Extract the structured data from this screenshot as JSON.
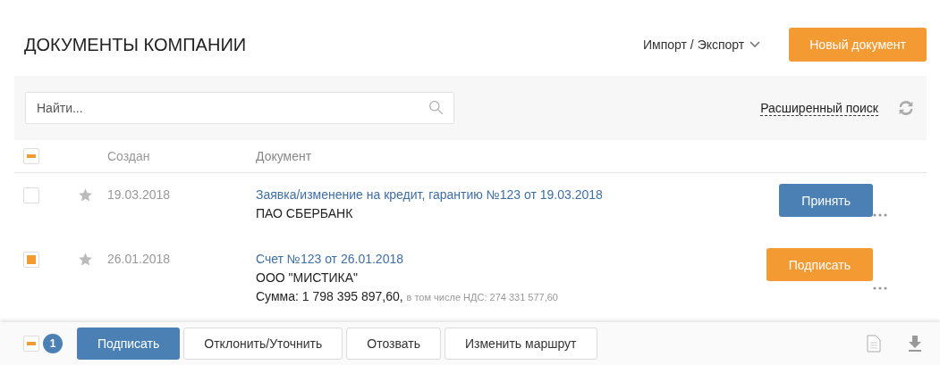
{
  "header": {
    "title": "ДОКУМЕНТЫ КОМПАНИИ",
    "import_export": "Импорт / Экспорт",
    "new_document": "Новый документ"
  },
  "search": {
    "placeholder": "Найти...",
    "advanced": "Расширенный поиск"
  },
  "table": {
    "select_all": {
      "checked": true,
      "mixed": true
    },
    "columns": [
      "Создан",
      "Документ"
    ],
    "rows": [
      {
        "checked": false,
        "date": "19.03.2018",
        "title": "Заявка/изменение на кредит, гарантию №123 от 19.03.2018",
        "company": "ПАО СБЕРБАНК",
        "action": {
          "label": "Принять",
          "kind": "primary"
        }
      },
      {
        "checked": true,
        "date": "26.01.2018",
        "title": "Счет №123 от 26.01.2018",
        "company": "ООО \"МИСТИКА\"",
        "sum": "Сумма: 1 798 395 897,60,",
        "vat": "в том числе НДС: 274 331 577,60",
        "action": {
          "label": "Подписать",
          "kind": "accent"
        }
      }
    ]
  },
  "bottom_bar": {
    "selection": {
      "checked": true,
      "mixed": true
    },
    "count": "1",
    "buttons": [
      {
        "label": "Подписать",
        "kind": "primary"
      },
      {
        "label": "Отклонить/Уточнить",
        "kind": "default"
      },
      {
        "label": "Отозвать",
        "kind": "default"
      },
      {
        "label": "Изменить маршрут",
        "kind": "default"
      }
    ]
  }
}
